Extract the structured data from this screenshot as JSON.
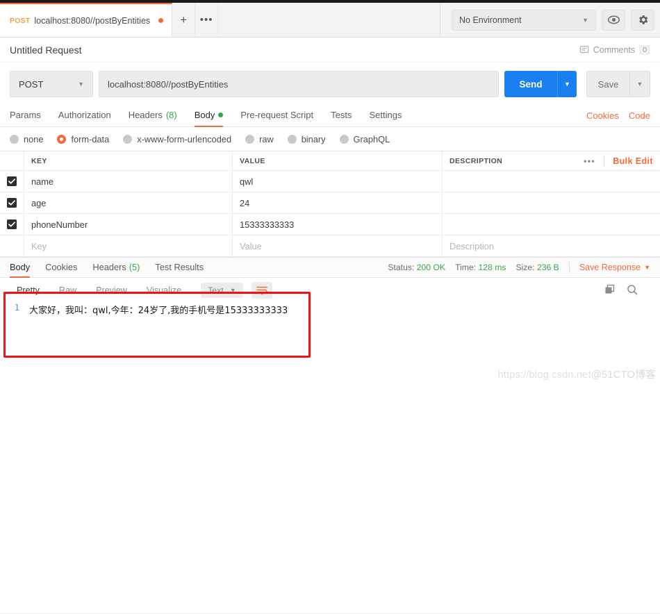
{
  "tabbar": {
    "request_tab": {
      "method": "POST",
      "title": "localhost:8080//postByEntities",
      "unsaved": "●"
    },
    "new_tab_label": "+",
    "more_label": "•••",
    "environment": {
      "selected": "No Environment",
      "caret": "▼"
    },
    "eye_icon": "eye-icon",
    "gear_icon": "gear-icon"
  },
  "title_row": {
    "request_name": "Untitled Request",
    "comments_label": "Comments",
    "comments_count": "0"
  },
  "url_row": {
    "method": "POST",
    "method_caret": "▼",
    "url": "localhost:8080//postByEntities",
    "send_label": "Send",
    "send_caret": "▼",
    "save_label": "Save",
    "save_caret": "▼"
  },
  "request_tabs": {
    "items": [
      {
        "label": "Params",
        "count": "",
        "active": false,
        "dot": false
      },
      {
        "label": "Authorization",
        "count": "",
        "active": false,
        "dot": false
      },
      {
        "label": "Headers",
        "count": "(8)",
        "active": false,
        "dot": false
      },
      {
        "label": "Body",
        "count": "",
        "active": true,
        "dot": true
      },
      {
        "label": "Pre-request Script",
        "count": "",
        "active": false,
        "dot": false
      },
      {
        "label": "Tests",
        "count": "",
        "active": false,
        "dot": false
      },
      {
        "label": "Settings",
        "count": "",
        "active": false,
        "dot": false
      }
    ],
    "cookies_link": "Cookies",
    "code_link": "Code"
  },
  "body_types": [
    {
      "label": "none",
      "selected": false
    },
    {
      "label": "form-data",
      "selected": true
    },
    {
      "label": "x-www-form-urlencoded",
      "selected": false
    },
    {
      "label": "raw",
      "selected": false
    },
    {
      "label": "binary",
      "selected": false
    },
    {
      "label": "GraphQL",
      "selected": false
    }
  ],
  "kv_table": {
    "headers": {
      "key": "KEY",
      "value": "VALUE",
      "description": "DESCRIPTION"
    },
    "dots_label": "•••",
    "bulk_edit": "Bulk Edit",
    "rows": [
      {
        "checked": true,
        "key": "name",
        "value": "qwl",
        "description": ""
      },
      {
        "checked": true,
        "key": "age",
        "value": "24",
        "description": ""
      },
      {
        "checked": true,
        "key": "phoneNumber",
        "value": "15333333333",
        "description": ""
      }
    ],
    "placeholder_row": {
      "key": "Key",
      "value": "Value",
      "description": "Description"
    }
  },
  "response": {
    "tabs": [
      {
        "label": "Body",
        "count": "",
        "active": true
      },
      {
        "label": "Cookies",
        "count": "",
        "active": false
      },
      {
        "label": "Headers",
        "count": "(5)",
        "active": false
      },
      {
        "label": "Test Results",
        "count": "",
        "active": false
      }
    ],
    "status_label": "Status:",
    "status_value": "200 OK",
    "time_label": "Time:",
    "time_value": "128 ms",
    "size_label": "Size:",
    "size_value": "236 B",
    "save_response": "Save Response",
    "save_response_caret": "▼"
  },
  "viewer": {
    "tabs": [
      {
        "label": "Pretty",
        "active": true
      },
      {
        "label": "Raw",
        "active": false
      },
      {
        "label": "Preview",
        "active": false
      },
      {
        "label": "Visualize",
        "active": false
      }
    ],
    "format_selected": "Text",
    "format_caret": "▼",
    "wrap_icon": "wrap-lines-icon",
    "copy_icon": "copy-icon",
    "search_icon": "search-icon",
    "line_number": "1",
    "line_text": "大家好，我叫：qwl,今年：24岁了,我的手机号是15333333333"
  },
  "watermark": {
    "url": "https://blog.csdn.net",
    "account": "@51CTO博客"
  },
  "colors": {
    "accent_orange": "#f26b3a",
    "send_blue": "#1a7ff0",
    "status_green": "#37a84a",
    "annotation_red": "#ef1313"
  }
}
